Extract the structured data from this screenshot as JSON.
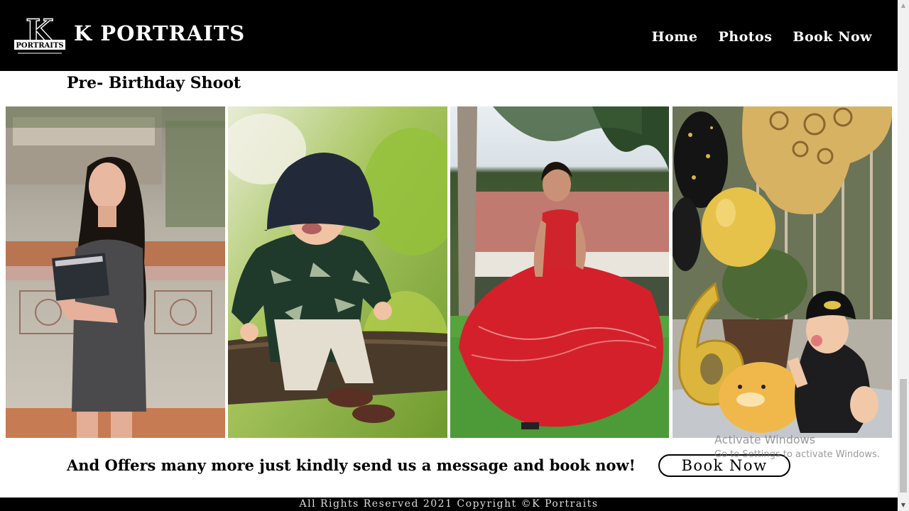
{
  "header": {
    "logo_letter": "K",
    "logo_text": "PORTRAITS",
    "brand": "K PORTRAITS",
    "nav": [
      {
        "label": "Home"
      },
      {
        "label": "Photos"
      },
      {
        "label": "Book Now"
      }
    ]
  },
  "main": {
    "section_title": "Pre- Birthday Shoot",
    "photos": [
      {
        "subject": "girl-holding-book"
      },
      {
        "subject": "toddler-in-bucket-hat"
      },
      {
        "subject": "woman-in-red-gown"
      },
      {
        "subject": "baby-with-balloons-number-6"
      }
    ],
    "offer_text": "And Offers many more just kindly send us a message and book now!",
    "book_button": "Book Now"
  },
  "watermark": {
    "line1": "Activate Windows",
    "line2": "Go to Settings to activate Windows."
  },
  "footer": {
    "text": "All Rights Reserved 2021 Copyright ©K Portraits"
  },
  "colors": {
    "header_bg": "#000000",
    "header_text": "#ffffff",
    "page_bg": "#ffffff"
  }
}
